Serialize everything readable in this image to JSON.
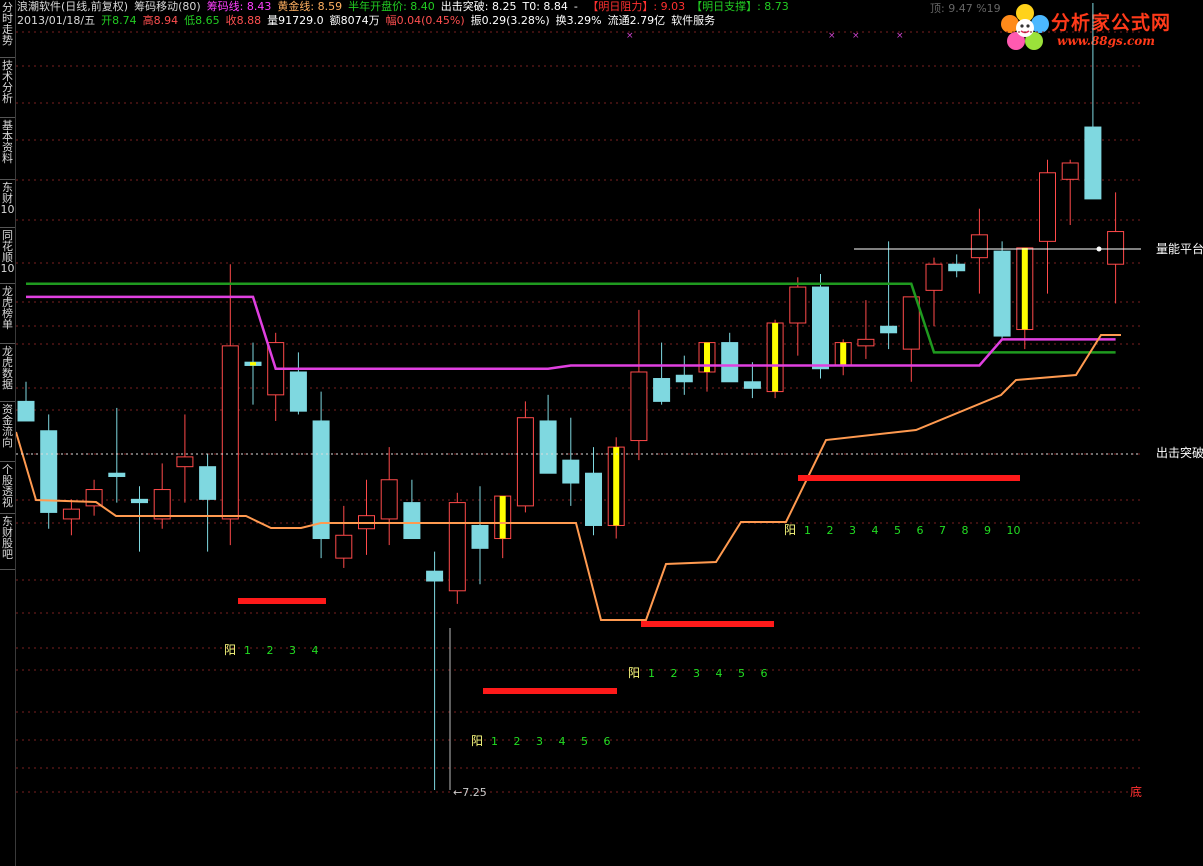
{
  "sidebar_tabs": [
    "分时走势",
    "技术分析",
    "基本资料",
    "东财10",
    "同花顺10",
    "龙虎榜单",
    "龙虎数据",
    "资金流向",
    "个股透视",
    "东财股吧"
  ],
  "header": {
    "line1": [
      {
        "text": "浪潮软件(日线,前复权)",
        "color": "#d8d8d8"
      },
      {
        "text": "筹码移动(80)",
        "color": "#d8d8d8"
      },
      {
        "text": "筹码线: 8.43",
        "color": "#ff40ff"
      },
      {
        "text": "黄金线: 8.59",
        "color": "#ffb060"
      },
      {
        "text": "半年开盘价: 8.40",
        "color": "#22cc22"
      },
      {
        "text": "出击突破: 8.25",
        "color": "#ffffff"
      },
      {
        "text": "T0: 8.84",
        "color": "#ffffff"
      },
      {
        "text": "- ",
        "color": "#ffffff"
      },
      {
        "text": "【明日阻力】: 9.03",
        "color": "#ff3030"
      },
      {
        "text": "【明日支撑】: 8.73",
        "color": "#22cc22"
      }
    ],
    "line2": [
      {
        "text": "2013/01/18/五",
        "color": "#d8d8d8"
      },
      {
        "text": "开8.74",
        "color": "#22cc22"
      },
      {
        "text": "高8.94",
        "color": "#ff5050"
      },
      {
        "text": "低8.65",
        "color": "#22cc22"
      },
      {
        "text": "收8.88",
        "color": "#ff5050"
      },
      {
        "text": "量91729.0",
        "color": "#ffffff"
      },
      {
        "text": "额8074万",
        "color": "#ffffff"
      },
      {
        "text": "幅0.04(0.45%)",
        "color": "#ff5050"
      },
      {
        "text": "振0.29(3.28%)",
        "color": "#ffffff"
      },
      {
        "text": "换3.29%",
        "color": "#ffffff"
      },
      {
        "text": "流通2.79亿",
        "color": "#ffffff"
      },
      {
        "text": "软件服务",
        "color": "#ffffff"
      }
    ],
    "top_right": "顶: 9.47  %19"
  },
  "logo": {
    "title": "分析家公式网",
    "url": "www.88gs.com"
  },
  "labels": {
    "right_volume": "量能平台",
    "right_break": "出击突破",
    "bottom_right": "底",
    "low_price": "7.25"
  },
  "colors": {
    "up": "#ff4a4a",
    "up_body": "#000000",
    "down": "#7fd8e0",
    "yellow": "#ffff00",
    "green_line": "#1f9a1f",
    "magenta_line": "#e040e0",
    "orange_line": "#ff9a50",
    "red_bar": "#ff1a1a",
    "grid": "#7a2020",
    "counter_green": "#22dd22",
    "counter_yang": "#ffff80"
  },
  "chart_data": {
    "type": "candlestick",
    "ylim": [
      7.0,
      10.0
    ],
    "candles": [
      {
        "o": 8.44,
        "h": 8.5,
        "l": 8.38,
        "c": 8.38,
        "hi": false
      },
      {
        "o": 8.35,
        "h": 8.4,
        "l": 8.05,
        "c": 8.1,
        "hi": false
      },
      {
        "o": 8.08,
        "h": 8.14,
        "l": 8.03,
        "c": 8.11,
        "hi": false
      },
      {
        "o": 8.12,
        "h": 8.2,
        "l": 8.09,
        "c": 8.17,
        "hi": false
      },
      {
        "o": 8.22,
        "h": 8.42,
        "l": 8.13,
        "c": 8.21,
        "hi": false
      },
      {
        "o": 8.14,
        "h": 8.18,
        "l": 7.98,
        "c": 8.13,
        "hi": false
      },
      {
        "o": 8.08,
        "h": 8.25,
        "l": 8.05,
        "c": 8.17,
        "hi": false
      },
      {
        "o": 8.24,
        "h": 8.4,
        "l": 8.13,
        "c": 8.27,
        "hi": false
      },
      {
        "o": 8.24,
        "h": 8.28,
        "l": 7.98,
        "c": 8.14,
        "hi": false
      },
      {
        "o": 8.08,
        "h": 8.86,
        "l": 8.0,
        "c": 8.61,
        "hi": false
      },
      {
        "o": 8.56,
        "h": 8.62,
        "l": 8.43,
        "c": 8.55,
        "hi": true
      },
      {
        "o": 8.46,
        "h": 8.65,
        "l": 8.38,
        "c": 8.62,
        "hi": false
      },
      {
        "o": 8.53,
        "h": 8.59,
        "l": 8.4,
        "c": 8.41,
        "hi": false
      },
      {
        "o": 8.38,
        "h": 8.47,
        "l": 7.96,
        "c": 8.02,
        "hi": false
      },
      {
        "o": 7.96,
        "h": 8.12,
        "l": 7.93,
        "c": 8.03,
        "hi": false
      },
      {
        "o": 8.05,
        "h": 8.2,
        "l": 7.97,
        "c": 8.09,
        "hi": false
      },
      {
        "o": 8.08,
        "h": 8.3,
        "l": 8.0,
        "c": 8.2,
        "hi": false
      },
      {
        "o": 8.13,
        "h": 8.2,
        "l": 8.03,
        "c": 8.02,
        "hi": false
      },
      {
        "o": 7.92,
        "h": 7.98,
        "l": 7.25,
        "c": 7.89,
        "hi": false
      },
      {
        "o": 7.86,
        "h": 8.16,
        "l": 7.82,
        "c": 8.13,
        "hi": false
      },
      {
        "o": 8.06,
        "h": 8.18,
        "l": 7.88,
        "c": 7.99,
        "hi": false
      },
      {
        "o": 8.02,
        "h": 8.09,
        "l": 7.96,
        "c": 8.15,
        "hi": true
      },
      {
        "o": 8.12,
        "h": 8.44,
        "l": 8.1,
        "c": 8.39,
        "hi": false
      },
      {
        "o": 8.38,
        "h": 8.46,
        "l": 8.23,
        "c": 8.22,
        "hi": false
      },
      {
        "o": 8.26,
        "h": 8.39,
        "l": 8.12,
        "c": 8.19,
        "hi": false
      },
      {
        "o": 8.22,
        "h": 8.3,
        "l": 8.03,
        "c": 8.06,
        "hi": false
      },
      {
        "o": 8.06,
        "h": 8.33,
        "l": 8.02,
        "c": 8.3,
        "hi": true
      },
      {
        "o": 8.32,
        "h": 8.72,
        "l": 8.26,
        "c": 8.53,
        "hi": false
      },
      {
        "o": 8.51,
        "h": 8.62,
        "l": 8.43,
        "c": 8.44,
        "hi": false
      },
      {
        "o": 8.52,
        "h": 8.58,
        "l": 8.46,
        "c": 8.5,
        "hi": false
      },
      {
        "o": 8.53,
        "h": 8.62,
        "l": 8.47,
        "c": 8.62,
        "hi": true
      },
      {
        "o": 8.62,
        "h": 8.65,
        "l": 8.51,
        "c": 8.5,
        "hi": false
      },
      {
        "o": 8.5,
        "h": 8.56,
        "l": 8.45,
        "c": 8.48,
        "hi": false
      },
      {
        "o": 8.47,
        "h": 8.69,
        "l": 8.45,
        "c": 8.68,
        "hi": true
      },
      {
        "o": 8.68,
        "h": 8.82,
        "l": 8.58,
        "c": 8.79,
        "hi": false
      },
      {
        "o": 8.79,
        "h": 8.83,
        "l": 8.51,
        "c": 8.54,
        "hi": false
      },
      {
        "o": 8.55,
        "h": 8.63,
        "l": 8.52,
        "c": 8.62,
        "hi": true
      },
      {
        "o": 8.61,
        "h": 8.75,
        "l": 8.57,
        "c": 8.63,
        "hi": false
      },
      {
        "o": 8.67,
        "h": 8.93,
        "l": 8.6,
        "c": 8.65,
        "hi": false
      },
      {
        "o": 8.6,
        "h": 8.76,
        "l": 8.5,
        "c": 8.76,
        "hi": false
      },
      {
        "o": 8.78,
        "h": 8.88,
        "l": 8.67,
        "c": 8.86,
        "hi": false
      },
      {
        "o": 8.86,
        "h": 8.89,
        "l": 8.82,
        "c": 8.84,
        "hi": false
      },
      {
        "o": 8.88,
        "h": 9.03,
        "l": 8.77,
        "c": 8.95,
        "hi": false
      },
      {
        "o": 8.9,
        "h": 8.93,
        "l": 8.63,
        "c": 8.64,
        "hi": false
      },
      {
        "o": 8.66,
        "h": 8.91,
        "l": 8.6,
        "c": 8.91,
        "hi": true
      },
      {
        "o": 8.93,
        "h": 9.18,
        "l": 8.77,
        "c": 9.14,
        "hi": false
      },
      {
        "o": 9.12,
        "h": 9.18,
        "l": 8.98,
        "c": 9.17,
        "hi": false
      },
      {
        "o": 9.28,
        "h": 9.66,
        "l": 9.13,
        "c": 9.06,
        "hi": false
      },
      {
        "o": 8.86,
        "h": 9.08,
        "l": 8.74,
        "c": 8.96,
        "hi": false
      }
    ],
    "lines": {
      "green": [
        8.8,
        8.8,
        8.8,
        8.8,
        8.8,
        8.8,
        8.8,
        8.8,
        8.8,
        8.8,
        8.8,
        8.8,
        8.8,
        8.8,
        8.8,
        8.8,
        8.8,
        8.8,
        8.8,
        8.8,
        8.8,
        8.8,
        8.8,
        8.8,
        8.8,
        8.8,
        8.8,
        8.8,
        8.8,
        8.8,
        8.8,
        8.8,
        8.8,
        8.8,
        8.8,
        8.8,
        8.8,
        8.8,
        8.8,
        8.8,
        8.59,
        8.59,
        8.59,
        8.59,
        8.59,
        8.59,
        8.59,
        8.59,
        8.59
      ],
      "magenta": [
        8.76,
        8.76,
        8.76,
        8.76,
        8.76,
        8.76,
        8.76,
        8.76,
        8.76,
        8.76,
        8.76,
        8.54,
        8.54,
        8.54,
        8.54,
        8.54,
        8.54,
        8.54,
        8.54,
        8.54,
        8.54,
        8.54,
        8.54,
        8.54,
        8.55,
        8.55,
        8.55,
        8.55,
        8.55,
        8.55,
        8.55,
        8.55,
        8.55,
        8.55,
        8.55,
        8.55,
        8.55,
        8.55,
        8.55,
        8.55,
        8.55,
        8.55,
        8.55,
        8.63,
        8.63,
        8.63,
        8.63,
        8.63,
        8.63
      ]
    }
  }
}
